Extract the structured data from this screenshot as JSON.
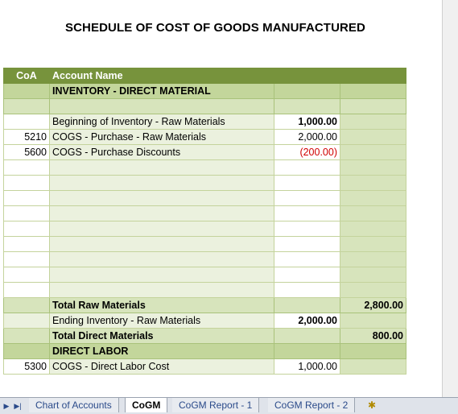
{
  "title": "SCHEDULE OF COST OF GOODS MANUFACTURED",
  "header": {
    "coa": "CoA",
    "account": "Account Name"
  },
  "section_direct_material": "INVENTORY - DIRECT MATERIAL",
  "lines": [
    {
      "coa": "",
      "name": "Beginning of Inventory - Raw Materials",
      "amount": "1,000.00"
    },
    {
      "coa": "5210",
      "name": "COGS - Purchase - Raw Materials",
      "amount": "2,000.00"
    },
    {
      "coa": "5600",
      "name": "COGS - Purchase Discounts",
      "amount": "(200.00)"
    }
  ],
  "total_raw_materials": {
    "label": "Total Raw Materials",
    "amount": "2,800.00"
  },
  "ending_inventory": {
    "label": "Ending Inventory - Raw Materials",
    "amount": "2,000.00"
  },
  "total_direct_materials": {
    "label": "Total Direct Materials",
    "amount": "800.00"
  },
  "section_direct_labor": "DIRECT LABOR",
  "labor_line": {
    "coa": "5300",
    "name": "COGS - Direct Labor Cost",
    "amount": "1,000.00"
  },
  "tabs": [
    "Chart of Accounts",
    "CoGM",
    "CoGM Report - 1",
    "CoGM Report - 2"
  ],
  "active_tab": "CoGM",
  "colors": {
    "header": "#77933c",
    "section": "#c3d69b",
    "band": "#d7e4bc",
    "negative": "#d00000"
  }
}
